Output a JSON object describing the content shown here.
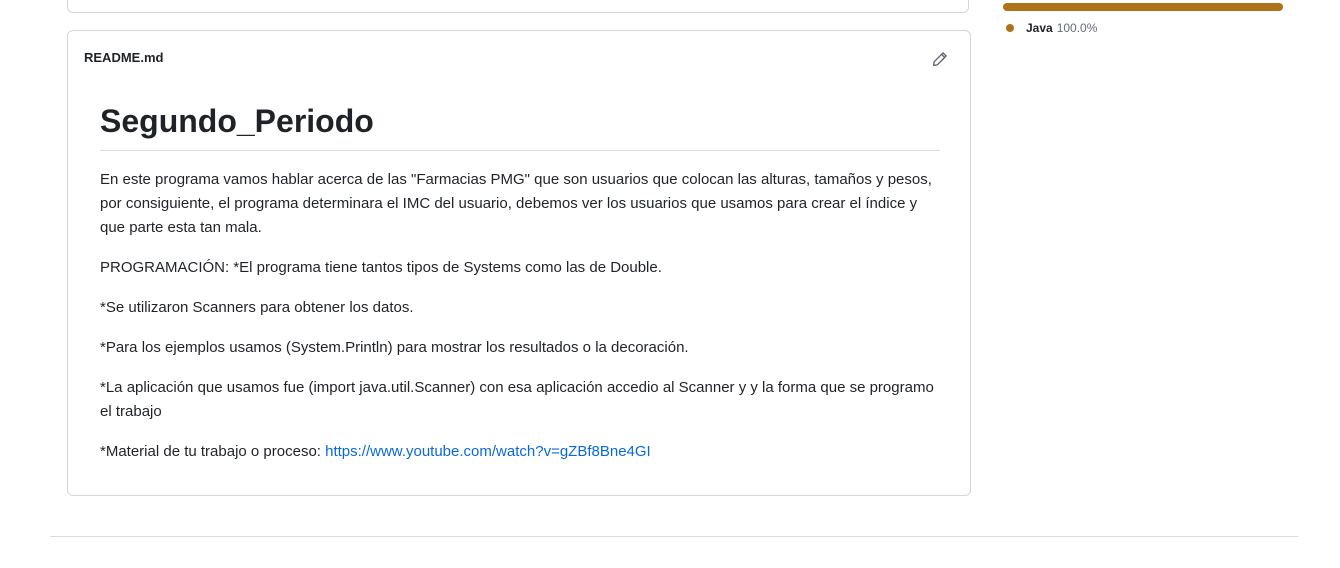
{
  "readme": {
    "filename": "README.md",
    "edit_icon": "pencil-icon",
    "title": "Segundo_Periodo",
    "paragraphs": [
      "En este programa vamos hablar acerca de las \"Farmacias PMG\" que son usuarios que colocan las alturas, tamaños y pesos, por consiguiente, el programa determinara el IMC del usuario, debemos ver los usuarios que usamos para crear el índice y que parte esta tan mala.",
      "PROGRAMACIÓN: *El programa tiene tantos tipos de Systems como las de Double.",
      "*Se utilizaron Scanners para obtener los datos.",
      "*Para los ejemplos usamos (System.Println) para mostrar los resultados o la decoración.",
      "*La aplicación que usamos fue (import java.util.Scanner) con esa aplicación accedio al Scanner y y la forma que se programo el trabajo"
    ],
    "material_prefix": "*Material de tu trabajo o proceso: ",
    "material_link": "https://www.youtube.com/watch?v=gZBf8Bne4GI"
  },
  "languages": {
    "items": [
      {
        "name": "Java",
        "percent": "100.0%",
        "color": "#b07219",
        "share": 1.0
      }
    ]
  }
}
